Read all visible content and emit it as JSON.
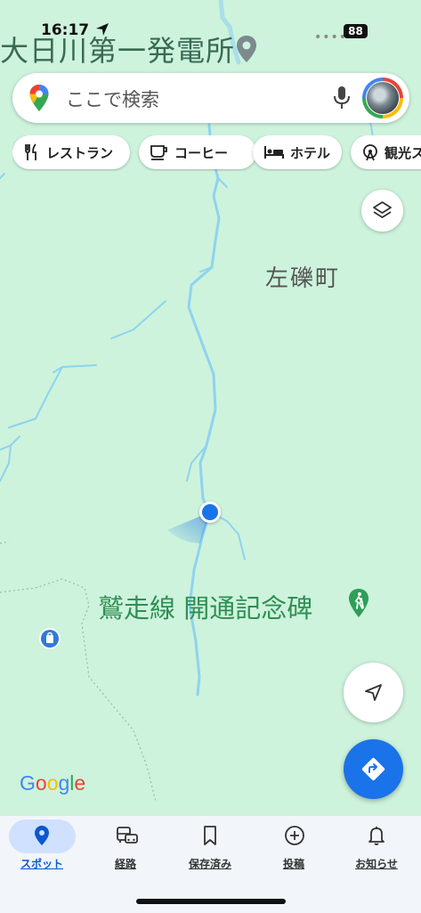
{
  "status_bar": {
    "time": "16:17",
    "battery": "88"
  },
  "map": {
    "top_place": "大日川第一発電所",
    "town": "左礫町",
    "poi_label": "鷲走線 開通記念碑",
    "google_logo": [
      "G",
      "o",
      "o",
      "g",
      "l",
      "e"
    ],
    "google_colors": [
      "#4285f4",
      "#ea4335",
      "#fbbc05",
      "#4285f4",
      "#34a853",
      "#ea4335"
    ],
    "water_color": "#8fd3ef",
    "land_color": "#cdf3dc",
    "accent": "#1a73e8"
  },
  "search": {
    "placeholder": "ここで検索"
  },
  "chips": [
    {
      "label": "レストラン",
      "icon": "restaurant-icon"
    },
    {
      "label": "コーヒー",
      "icon": "coffee-icon"
    },
    {
      "label": "ホテル",
      "icon": "hotel-icon"
    },
    {
      "label": "観光ス",
      "icon": "attractions-icon"
    }
  ],
  "nav": [
    {
      "label": "スポット",
      "icon": "pin-icon",
      "active": true
    },
    {
      "label": "経路",
      "icon": "commute-icon",
      "active": false
    },
    {
      "label": "保存済み",
      "icon": "bookmark-icon",
      "active": false
    },
    {
      "label": "投稿",
      "icon": "add-circle-icon",
      "active": false
    },
    {
      "label": "お知らせ",
      "icon": "bell-icon",
      "active": false
    }
  ]
}
